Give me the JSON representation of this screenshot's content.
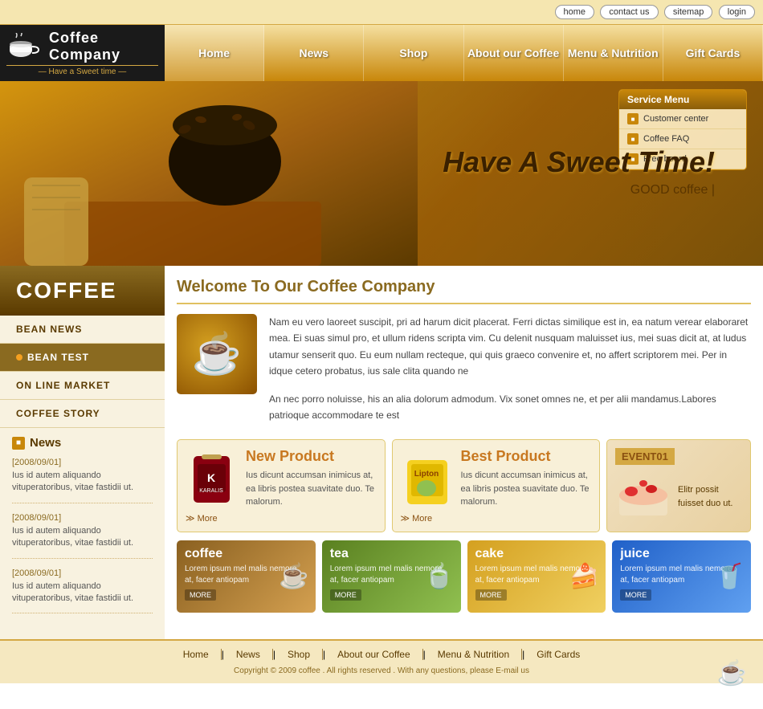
{
  "topbar": {
    "links": [
      "home",
      "contact us",
      "sitemap",
      "login"
    ]
  },
  "header": {
    "logo_name": "Coffee Company",
    "logo_tagline": "— Have a Sweet time —",
    "nav": [
      {
        "label": "Home",
        "active": true
      },
      {
        "label": "News",
        "active": false
      },
      {
        "label": "Shop",
        "active": false
      },
      {
        "label": "About our Coffee",
        "active": false
      },
      {
        "label": "Menu & Nutrition",
        "active": false
      },
      {
        "label": "Gift Cards",
        "active": false
      }
    ]
  },
  "hero": {
    "title": "Have A Sweet Time!",
    "subtitle": "GOOD coffee  |"
  },
  "service_menu": {
    "title": "Service Menu",
    "items": [
      "Customer center",
      "Coffee FAQ",
      "Free board"
    ]
  },
  "sidebar": {
    "coffee_label": "COFFEE",
    "menu": [
      {
        "label": "BEAN NEWS",
        "active": false
      },
      {
        "label": "BEAN TEST",
        "active": true
      },
      {
        "label": "ON LINE MARKET",
        "active": false
      },
      {
        "label": "COFFEE STORY",
        "active": false
      }
    ]
  },
  "sidebar_news": {
    "title": "News",
    "items": [
      {
        "date": "[2008/09/01]",
        "text": "Ius id autem aliquando vituperatoribus, vitae fastidii ut."
      },
      {
        "date": "[2008/09/01]",
        "text": "Ius id autem aliquando vituperatoribus, vitae fastidii ut."
      },
      {
        "date": "[2008/09/01]",
        "text": "Ius id autem aliquando vituperatoribus, vitae fastidii ut."
      }
    ]
  },
  "welcome": {
    "title": "Welcome To Our Coffee Company",
    "paragraph1": "Nam eu vero laoreet suscipit, pri ad harum dicit placerat. Ferri dictas similique est in, ea natum verear elaboraret mea. Ei suas simul pro, et ullum ridens scripta vim. Cu delenit nusquam maluisset ius, mei suas dicit at, at ludus utamur senserit quo. Eu eum nullam recteque, qui quis graeco convenire et, no affert scriptorem mei. Per in idque cetero probatus, ius sale clita quando ne",
    "paragraph2": "An nec porro noluisse, his an alia dolorum admodum. Vix sonet omnes ne, et per alii  mandamus.Labores patrioque accommodare te est"
  },
  "new_product": {
    "title": "New Product",
    "desc": "Ius dicunt accumsan inimicus at, ea libris postea suavitate duo. Te malorum.",
    "more": "≫ More"
  },
  "best_product": {
    "title": "Best Product",
    "desc": "Ius dicunt accumsan inimicus at, ea libris postea suavitate duo. Te malorum.",
    "more": "≫ More"
  },
  "event": {
    "label": "EVENT01",
    "desc": "Elitr possit fuisset duo ut."
  },
  "categories": [
    {
      "key": "coffee",
      "title": "coffee",
      "desc": "Lorem ipsum mel malis nemore at, facer antiopam",
      "icon": "☕",
      "more": "MORE"
    },
    {
      "key": "tea",
      "title": "tea",
      "desc": "Lorem ipsum mel malis nemore at, facer antiopam",
      "icon": "🍵",
      "more": "MORE"
    },
    {
      "key": "cake",
      "title": "cake",
      "desc": "Lorem ipsum mel malis nemore at, facer antiopam",
      "icon": "🍰",
      "more": "MORE"
    },
    {
      "key": "juice",
      "title": "juice",
      "desc": "Lorem ipsum mel malis nemore at, facer antiopam",
      "icon": "🥤",
      "more": "MORE"
    }
  ],
  "footer": {
    "nav": [
      "Home",
      "News",
      "Shop",
      "About our Coffee",
      "Menu & Nutrition",
      "Gift Cards"
    ],
    "copyright": "Copyright © 2009 coffee . All rights reserved . With any questions, please E-mail us"
  }
}
